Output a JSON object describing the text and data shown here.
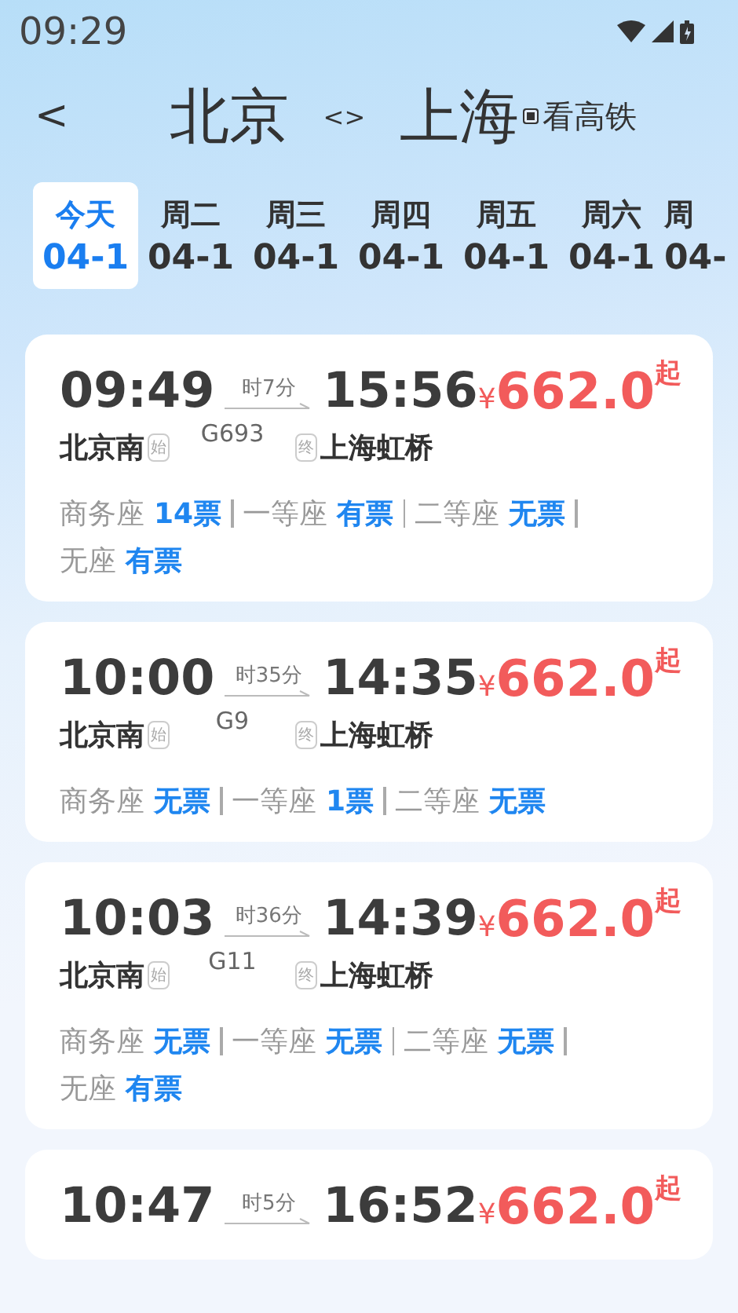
{
  "status_bar": {
    "time": "09:29"
  },
  "header": {
    "back": "<",
    "from": "北京",
    "swap": "<>",
    "to": "上海",
    "toggle_label": "看高铁",
    "toggle_checked": true
  },
  "dates": [
    {
      "weekday": "今天",
      "date": "04-1",
      "selected": true
    },
    {
      "weekday": "周二",
      "date": "04-1",
      "selected": false
    },
    {
      "weekday": "周三",
      "date": "04-1",
      "selected": false
    },
    {
      "weekday": "周四",
      "date": "04-1",
      "selected": false
    },
    {
      "weekday": "周五",
      "date": "04-1",
      "selected": false
    },
    {
      "weekday": "周六",
      "date": "04-1",
      "selected": false
    },
    {
      "weekday": "周",
      "date": "04-",
      "selected": false
    }
  ],
  "trains": [
    {
      "depart": "09:49",
      "duration": "时7分",
      "arrive": "15:56",
      "currency": "¥",
      "price": "662.0",
      "price_suffix": "起",
      "from_station": "北京南",
      "from_tag": "始",
      "number": "G693",
      "to_tag": "终",
      "to_station": "上海虹桥",
      "seats": [
        {
          "name": "商务座",
          "status": "14票"
        },
        {
          "name": "一等座",
          "status": "有票"
        },
        {
          "name": "二等座",
          "status": "无票"
        },
        {
          "name": "无座",
          "status": "有票"
        }
      ]
    },
    {
      "depart": "10:00",
      "duration": "时35分",
      "arrive": "14:35",
      "currency": "¥",
      "price": "662.0",
      "price_suffix": "起",
      "from_station": "北京南",
      "from_tag": "始",
      "number": "G9",
      "to_tag": "终",
      "to_station": "上海虹桥",
      "seats": [
        {
          "name": "商务座",
          "status": "无票"
        },
        {
          "name": "一等座",
          "status": "1票"
        },
        {
          "name": "二等座",
          "status": "无票"
        }
      ]
    },
    {
      "depart": "10:03",
      "duration": "时36分",
      "arrive": "14:39",
      "currency": "¥",
      "price": "662.0",
      "price_suffix": "起",
      "from_station": "北京南",
      "from_tag": "始",
      "number": "G11",
      "to_tag": "终",
      "to_station": "上海虹桥",
      "seats": [
        {
          "name": "商务座",
          "status": "无票"
        },
        {
          "name": "一等座",
          "status": "无票"
        },
        {
          "name": "二等座",
          "status": "无票"
        },
        {
          "name": "无座",
          "status": "有票"
        }
      ]
    },
    {
      "depart": "10:47",
      "duration": "时5分",
      "arrive": "16:52",
      "currency": "¥",
      "price": "662.0",
      "price_suffix": "起"
    }
  ]
}
